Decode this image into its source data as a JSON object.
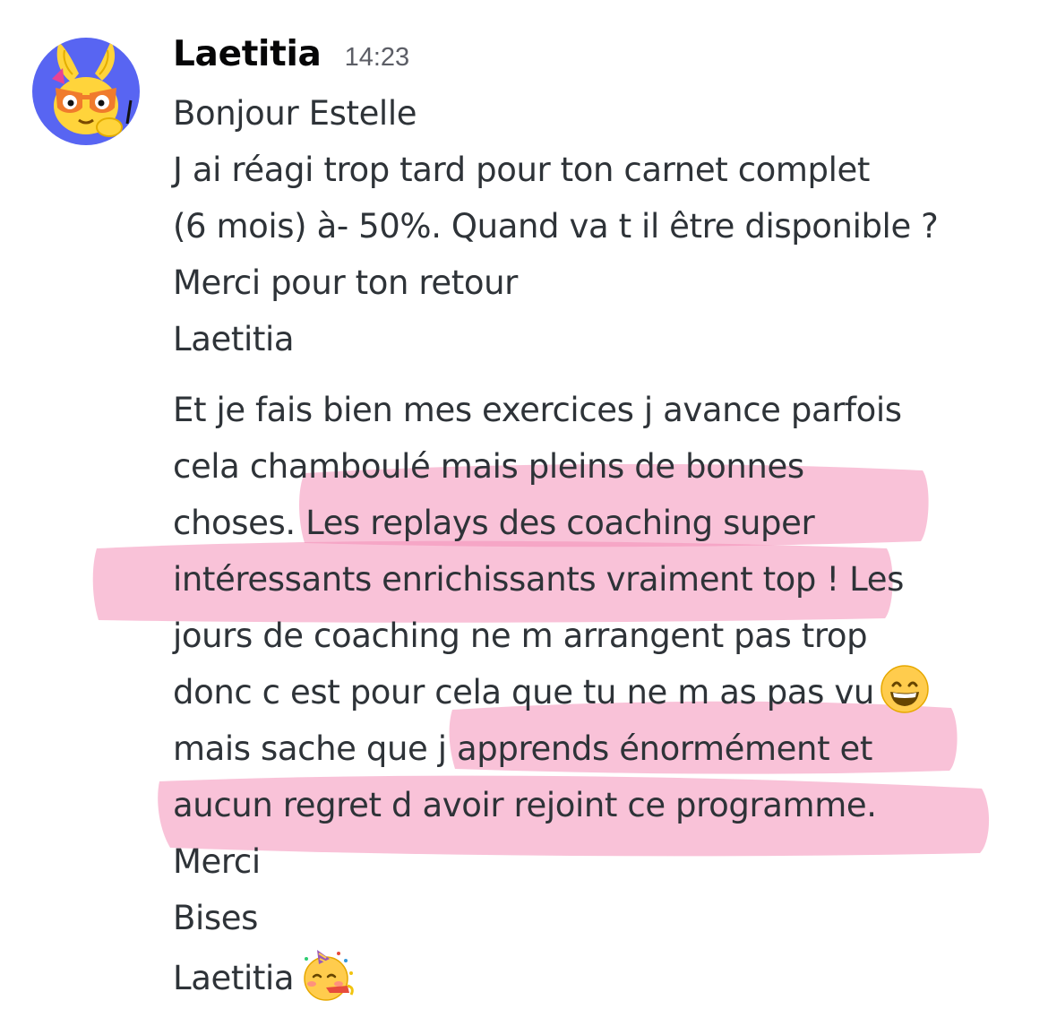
{
  "message": {
    "author": "Laetitia",
    "timestamp": "14:23",
    "paragraph1": [
      "Bonjour Estelle",
      "J ai réagi trop tard pour ton  carnet complet",
      "(6 mois) à- 50%. Quand va t il être disponible ?",
      "Merci pour ton retour",
      "Laetitia"
    ],
    "paragraph2": [
      "Et je fais bien mes exercices j avance parfois",
      "cela chamboulé mais pleins de bonnes",
      "choses. Les replays des coaching super",
      "intéressants enrichissants vraiment top ! Les",
      "jours de coaching ne m arrangent pas trop",
      "donc c est pour cela que tu ne m as pas vu",
      "mais sache que j apprends énormément et",
      "aucun regret d avoir rejoint ce programme.",
      "Merci",
      "Bises",
      "Laetitia"
    ],
    "emojis": {
      "grin": "grinning-face-emoji",
      "party": "partying-face-emoji"
    }
  },
  "colors": {
    "highlight": "#f48fb8",
    "text": "#2e3338",
    "author": "#060607",
    "timestamp": "#5c5e66",
    "avatar_bg": "#5865f2",
    "avatar_face": "#ffd43b"
  }
}
